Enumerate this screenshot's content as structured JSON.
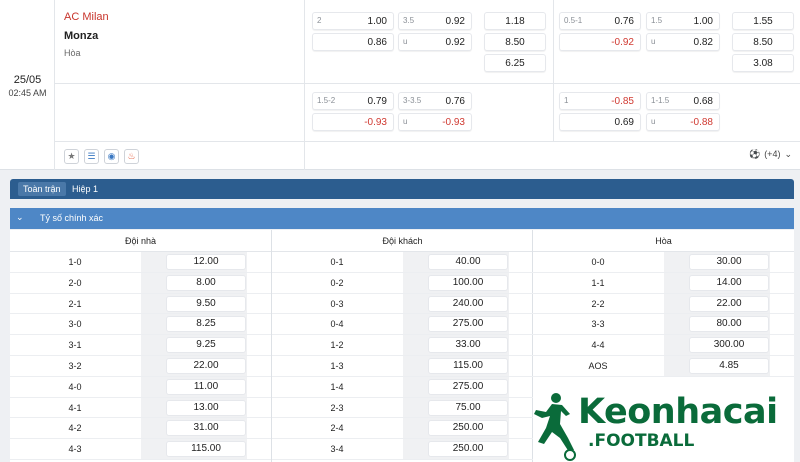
{
  "match": {
    "date": "25/05",
    "time": "02:45 AM",
    "home": "AC Milan",
    "away": "Monza",
    "draw": "Hòa"
  },
  "odds": {
    "r1": {
      "hcp_h": "2",
      "hcp_h_v": "1.00",
      "ou_h": "3.5",
      "ou_h_v": "0.92",
      "x_h": "1.18",
      "hcp2_h": "0.5-1",
      "hcp2_h_v": "0.76",
      "ou2_h": "1.5",
      "ou2_h_v": "1.00",
      "x2_h": "1.55"
    },
    "r2": {
      "hcp_a_v": "0.86",
      "ou_u": "u",
      "ou_a_v": "0.92",
      "x_a": "8.50",
      "hcp2_a_v": "-0.92",
      "ou2_u": "u",
      "ou2_a_v": "0.82",
      "x2_a": "8.50"
    },
    "r3": {
      "x_d": "6.25",
      "x2_d": "3.08"
    },
    "r4": {
      "hcp_h": "1.5-2",
      "hcp_h_v": "0.79",
      "ou_h": "3-3.5",
      "ou_h_v": "0.76",
      "hcp2_h": "1",
      "hcp2_h_v": "-0.85",
      "ou2_h": "1-1.5",
      "ou2_h_v": "0.68"
    },
    "r5": {
      "hcp_a_v": "-0.93",
      "ou_u": "u",
      "ou_a_v": "-0.93",
      "hcp2_a_v": "0.69",
      "ou2_u": "u",
      "ou2_a_v": "-0.88"
    }
  },
  "more": {
    "count": "(+4)"
  },
  "tabs": [
    "Toàn trận",
    "Hiệp 1"
  ],
  "section": {
    "title": "Tỷ số chính xác"
  },
  "columns": [
    {
      "header": "Đội nhà",
      "rows": [
        {
          "s": "1-0",
          "o": "12.00"
        },
        {
          "s": "2-0",
          "o": "8.00"
        },
        {
          "s": "2-1",
          "o": "9.50"
        },
        {
          "s": "3-0",
          "o": "8.25"
        },
        {
          "s": "3-1",
          "o": "9.25"
        },
        {
          "s": "3-2",
          "o": "22.00"
        },
        {
          "s": "4-0",
          "o": "11.00"
        },
        {
          "s": "4-1",
          "o": "13.00"
        },
        {
          "s": "4-2",
          "o": "31.00"
        },
        {
          "s": "4-3",
          "o": "115.00"
        }
      ]
    },
    {
      "header": "Đội khách",
      "rows": [
        {
          "s": "0-1",
          "o": "40.00"
        },
        {
          "s": "0-2",
          "o": "100.00"
        },
        {
          "s": "0-3",
          "o": "240.00"
        },
        {
          "s": "0-4",
          "o": "275.00"
        },
        {
          "s": "1-2",
          "o": "33.00"
        },
        {
          "s": "1-3",
          "o": "115.00"
        },
        {
          "s": "1-4",
          "o": "275.00"
        },
        {
          "s": "2-3",
          "o": "75.00"
        },
        {
          "s": "2-4",
          "o": "250.00"
        },
        {
          "s": "3-4",
          "o": "250.00"
        }
      ]
    },
    {
      "header": "Hòa",
      "rows": [
        {
          "s": "0-0",
          "o": "30.00"
        },
        {
          "s": "1-1",
          "o": "14.00"
        },
        {
          "s": "2-2",
          "o": "22.00"
        },
        {
          "s": "3-3",
          "o": "80.00"
        },
        {
          "s": "4-4",
          "o": "300.00"
        },
        {
          "s": "AOS",
          "o": "4.85"
        }
      ]
    }
  ],
  "logo": {
    "word": "Keonhacai",
    "sub": ".FOOTBALL"
  },
  "icons": [
    "star-icon",
    "database-icon",
    "eye-icon",
    "fire-icon",
    "soccer-ball-icon",
    "double-chevron-down-icon"
  ]
}
